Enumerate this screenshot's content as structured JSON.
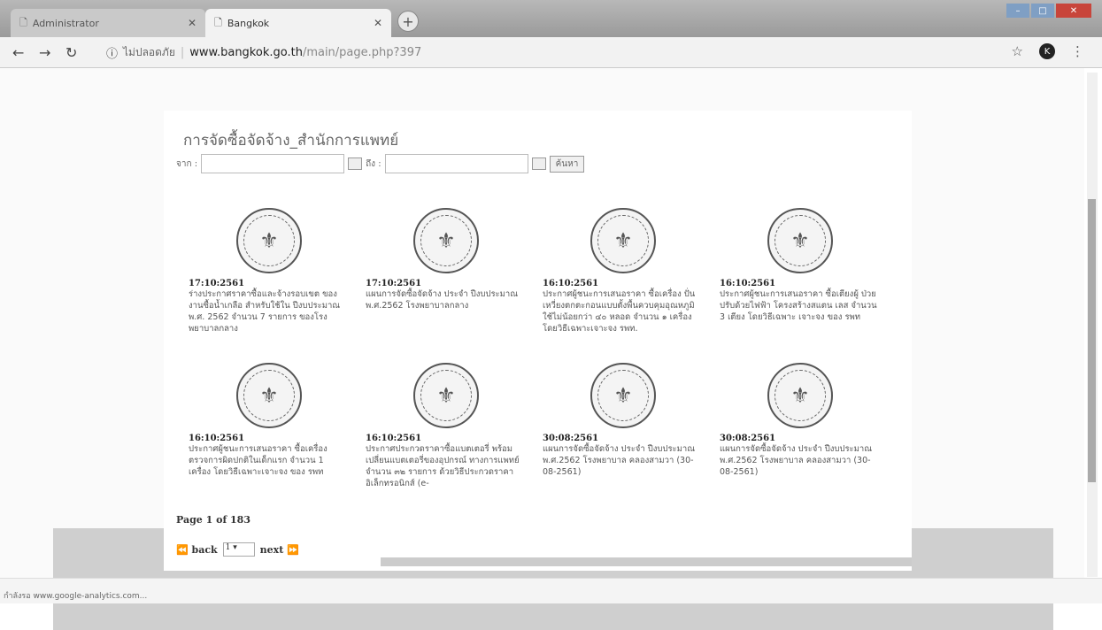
{
  "browser": {
    "tabs": [
      {
        "label": "Administrator",
        "active": false
      },
      {
        "label": "Bangkok",
        "active": true
      }
    ],
    "address": {
      "security_label": "ไม่ปลอดภัย",
      "host": "www.bangkok.go.th",
      "path": "/main/page.php?397"
    },
    "avatar_initial": "K",
    "status_text": "กำลังรอ www.google-analytics.com..."
  },
  "page": {
    "heading": "การจัดซื้อจัดจ้าง_สำนักการแพทย์",
    "search": {
      "from_label": "จาก :",
      "to_label": "ถึง :",
      "button_label": "ค้นหา"
    },
    "items": [
      {
        "date": "17:10:2561",
        "text": "ร่างประกาศราคาซื้อและจ้างรอบเขต ของงานซื้อน้ำเกลือ สำหรับใช้ใน ปีงบประมาณ พ.ศ. 2562 จำนวน 7 รายการ ของโรงพยาบาลกลาง"
      },
      {
        "date": "17:10:2561",
        "text": "แผนการจัดซื้อจัดจ้าง ประจำ ปีงบประมาณ พ.ศ.2562 โรงพยาบาลกลาง"
      },
      {
        "date": "16:10:2561",
        "text": "ประกาศผู้ชนะการเสนอราคา ซื้อเครื่อง ปั่นเหวี่ยงตกตะกอนแบบตั้งพื้นควบคุมอุณหภูมิ ใช้ไม่น้อยกว่า ๔๐ หลอด จำนวน ๑ เครื่อง โดยวิธีเฉพาะเจาะจง รพท."
      },
      {
        "date": "16:10:2561",
        "text": "ประกาศผู้ชนะการเสนอราคา ซื้อเตียงผู้ ป่วยปรับด้วยไฟฟ้า โครงสร้างสแตน เลส จำนวน 3 เตียง โดยวิธีเฉพาะ เจาะจง ของ รพท"
      },
      {
        "date": "16:10:2561",
        "text": "ประกาศผู้ชนะการเสนอราคา ซื้อเครื่อง ตรวจการผิดปกติในเด็กแรก จำนวน 1 เครื่อง โดยวิธีเฉพาะเจาะจง ของ รพท"
      },
      {
        "date": "16:10:2561",
        "text": "ประกาศประกวดราคาซื้อแบตเตอรี่ พร้อมเปลี่ยนแบตเตอรี่ของอุปกรณ์ ทางการแพทย์ จำนวน ๓๒ รายการ ด้วยวิธีประกวดราคาอิเล็กทรอนิกส์ (e-"
      },
      {
        "date": "30:08:2561",
        "text": "แผนการจัดซื้อจัดจ้าง ประจำ ปีงบประมาณ พ.ศ.2562 โรงพยาบาล คลองสามวา (30-08-2561)"
      },
      {
        "date": "30:08:2561",
        "text": "แผนการจัดซื้อจัดจ้าง ประจำ ปีงบประมาณ พ.ศ.2562 โรงพยาบาล คลองสามวา (30-08-2561)"
      }
    ],
    "pagination": {
      "summary": "Page 1 of 183",
      "back_label": "back",
      "next_label": "next",
      "current": "1"
    }
  }
}
